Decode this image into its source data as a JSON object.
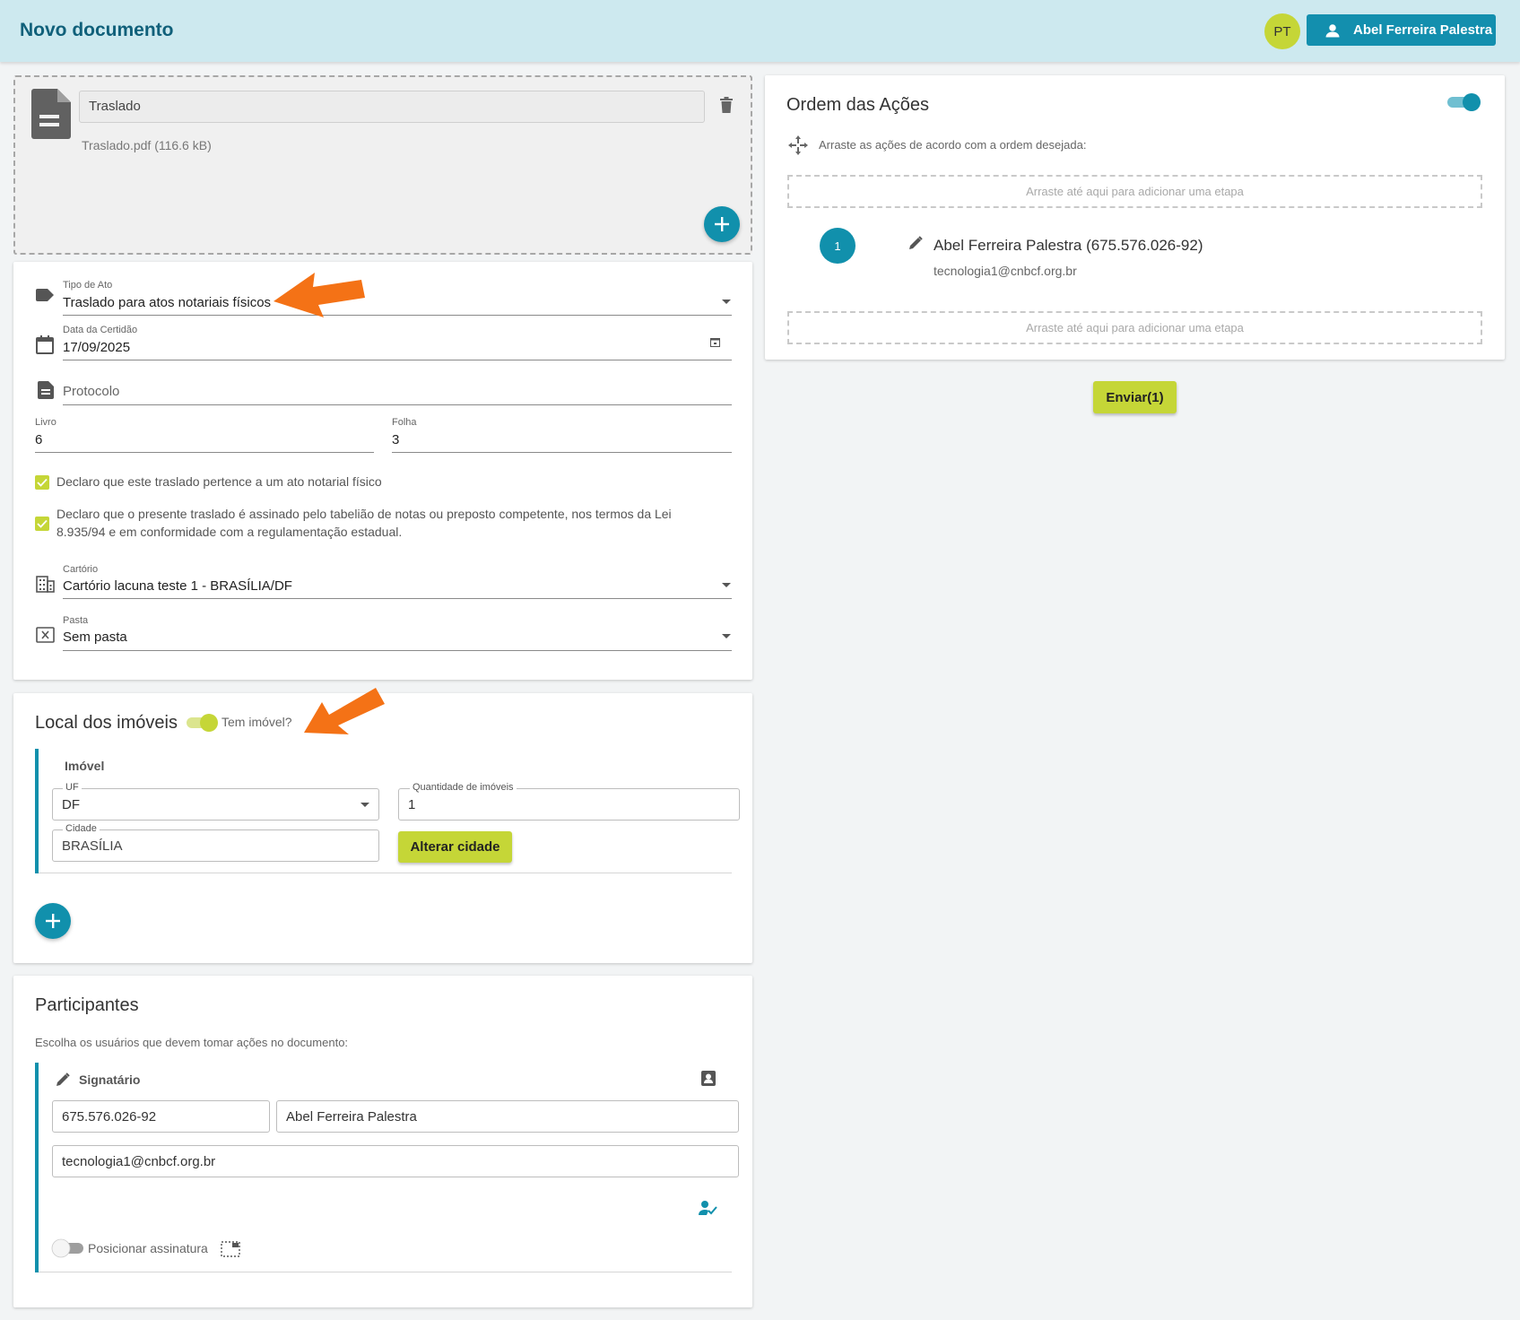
{
  "header": {
    "title": "Novo documento",
    "avatar_initials": "PT",
    "user_name": "Abel Ferreira Palestra"
  },
  "upload": {
    "document_name": "Traslado",
    "file_info": "Traslado.pdf (116.6 kB)"
  },
  "form": {
    "tipo_ato": {
      "label": "Tipo de Ato",
      "value": "Traslado para atos notariais físicos"
    },
    "data_certidao": {
      "label": "Data da Certidão",
      "value": "17/09/2025"
    },
    "protocolo": {
      "placeholder": "Protocolo"
    },
    "livro": {
      "label": "Livro",
      "value": "6"
    },
    "folha": {
      "label": "Folha",
      "value": "3"
    },
    "check1": "Declaro que este traslado pertence a um ato notarial físico",
    "check2_line1": "Declaro que o presente traslado é assinado pelo tabelião de notas ou preposto competente, nos termos da Lei",
    "check2_line2": "8.935/94 e em conformidade com a regulamentação estadual.",
    "cartorio": {
      "label": "Cartório",
      "value": "Cartório lacuna teste 1 - BRASÍLIA/DF"
    },
    "pasta": {
      "label": "Pasta",
      "value": "Sem pasta"
    }
  },
  "imoveis": {
    "title": "Local dos imóveis",
    "toggle_label": "Tem imóvel?",
    "toggle_on": true,
    "subheading": "Imóvel",
    "uf": {
      "label": "UF",
      "value": "DF"
    },
    "quantidade": {
      "label": "Quantidade de imóveis",
      "value": "1"
    },
    "cidade": {
      "label": "Cidade",
      "value": "BRASÍLIA"
    },
    "alterar_button": "Alterar cidade"
  },
  "participantes": {
    "title": "Participantes",
    "subtitle": "Escolha os usuários que devem tomar ações no documento:",
    "role": "Signatário",
    "cpf": "675.576.026-92",
    "name": "Abel Ferreira Palestra",
    "email": "tecnologia1@cnbcf.org.br",
    "posicionar_label": "Posicionar assinatura",
    "posicionar_on": false
  },
  "ordem": {
    "title": "Ordem das Ações",
    "toggle_on": true,
    "instructions": "Arraste as ações de acordo com a ordem desejada:",
    "dropzone_text": "Arraste até aqui para adicionar uma etapa",
    "steps": [
      {
        "number": "1",
        "name": "Abel Ferreira Palestra (675.576.026-92)",
        "email": "tecnologia1@cnbcf.org.br"
      }
    ]
  },
  "send_button": "Enviar(1)",
  "colors": {
    "header_bg": "#cde9ef",
    "primary": "#138fae",
    "accent_lime": "#c5d637",
    "annotation_arrow": "#f47216"
  },
  "icons": [
    "person-icon",
    "document-icon",
    "trash-icon",
    "plus-icon",
    "label-icon",
    "calendar-icon",
    "calendar-small-icon",
    "notes-icon",
    "checkbox-icon",
    "building-icon",
    "folder-x-icon",
    "pencil-icon",
    "contact-card-icon",
    "person-check-icon",
    "signature-box-icon",
    "move-icon",
    "arrow-annotation-icon"
  ]
}
